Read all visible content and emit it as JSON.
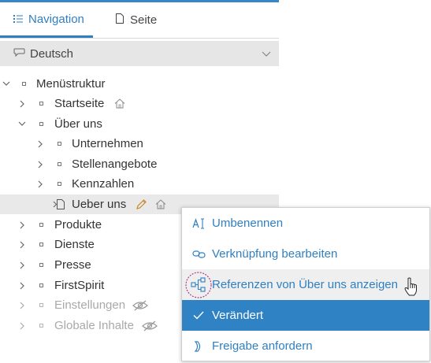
{
  "tabs": {
    "navigation": "Navigation",
    "page": "Seite"
  },
  "language": {
    "selected": "Deutsch"
  },
  "tree": {
    "root": "Menüstruktur",
    "items": [
      {
        "label": "Startseite"
      },
      {
        "label": "Über uns"
      },
      {
        "label": "Unternehmen"
      },
      {
        "label": "Stellenangebote"
      },
      {
        "label": "Kennzahlen"
      },
      {
        "label": "Ueber uns"
      },
      {
        "label": "Produkte"
      },
      {
        "label": "Dienste"
      },
      {
        "label": "Presse"
      },
      {
        "label": "FirstSpirit"
      },
      {
        "label": "Einstellungen"
      },
      {
        "label": "Globale Inhalte"
      }
    ]
  },
  "context_menu": {
    "items": [
      {
        "label": "Umbenennen",
        "icon": "rename-icon"
      },
      {
        "label": "Verknüpfung bearbeiten",
        "icon": "link-icon"
      },
      {
        "label": "Referenzen von Über uns anzeigen",
        "icon": "references-icon"
      },
      {
        "label": "Verändert",
        "icon": "check-icon"
      },
      {
        "label": "Freigabe anfordern",
        "icon": "release-icon"
      }
    ]
  },
  "colors": {
    "accent": "#2f7fc1",
    "active_bg": "#2f82c4",
    "selected_row": "#e9e9e9",
    "edit_icon": "#c98a2a"
  }
}
